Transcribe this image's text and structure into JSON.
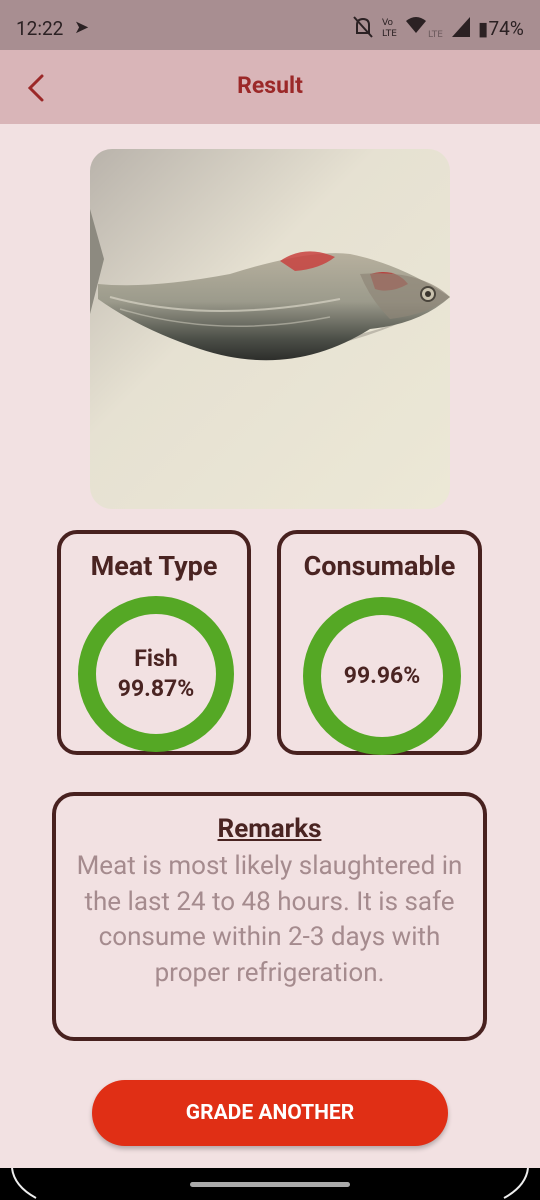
{
  "status_bar": {
    "time": "12:22",
    "battery": "74%",
    "icons": [
      "telegram-icon",
      "mute-icon",
      "volte-icon",
      "wifi-icon",
      "signal-icon",
      "battery-icon"
    ]
  },
  "app_bar": {
    "title": "Result",
    "back_icon": "chevron-left-icon"
  },
  "photo": {
    "subject": "fish-photo"
  },
  "meat_type": {
    "title": "Meat Type",
    "label": "Fish",
    "value": "99.87%",
    "progress": 0.9987,
    "ring_color": "#55a825"
  },
  "consumable": {
    "title": "Consumable",
    "value": "99.96%",
    "progress": 0.9996,
    "ring_color": "#55a825"
  },
  "remarks": {
    "title": "Remarks",
    "body": "Meat is most likely slaughtered in the last 24 to 48 hours. It is safe consume within 2-3 days with proper refrigeration."
  },
  "actions": {
    "grade_another": "GRADE ANOTHER"
  },
  "colors": {
    "background": "#f2e1e2",
    "app_bar": "#d9b5b8",
    "status_bar": "#a88e91",
    "title_red": "#9b2828",
    "border_brown": "#48211f",
    "button_red": "#e02f15",
    "ring_green": "#55a825"
  }
}
